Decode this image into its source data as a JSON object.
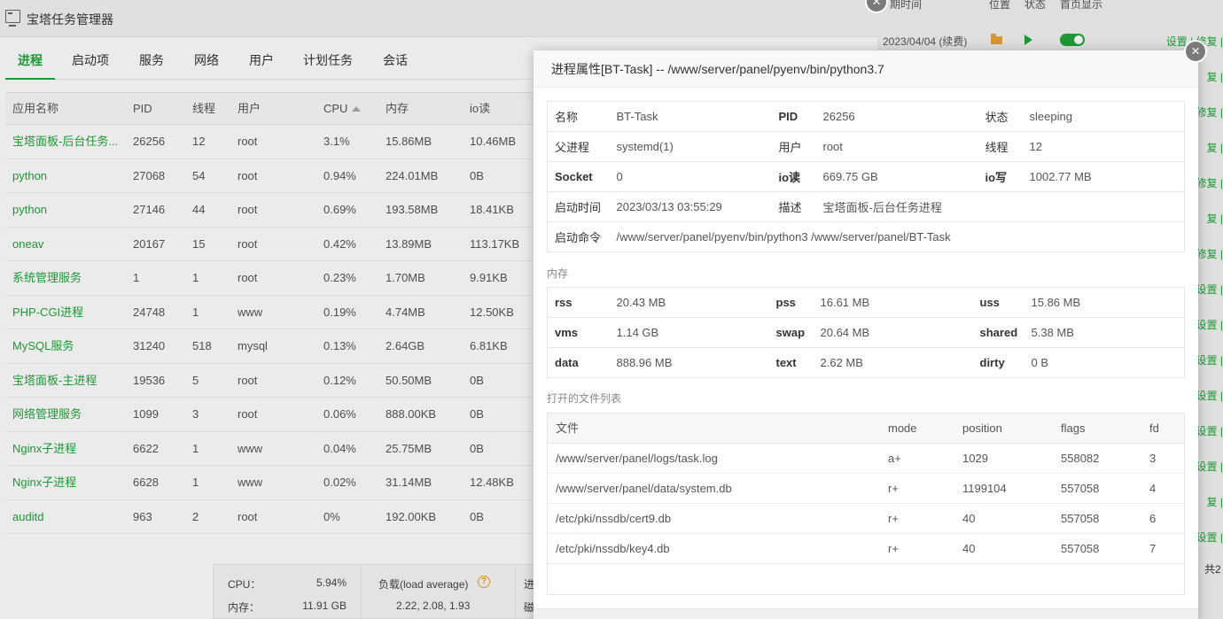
{
  "app": {
    "title": "宝塔任务管理器"
  },
  "tabs": [
    "进程",
    "启动项",
    "服务",
    "网络",
    "用户",
    "计划任务",
    "会话"
  ],
  "process_table": {
    "columns": [
      "应用名称",
      "PID",
      "线程",
      "用户",
      "CPU",
      "内存",
      "io读"
    ],
    "rows": [
      [
        "宝塔面板-后台任务...",
        "26256",
        "12",
        "root",
        "3.1%",
        "15.86MB",
        "10.46MB"
      ],
      [
        "python",
        "27068",
        "54",
        "root",
        "0.94%",
        "224.01MB",
        "0B"
      ],
      [
        "python",
        "27146",
        "44",
        "root",
        "0.69%",
        "193.58MB",
        "18.41KB"
      ],
      [
        "oneav",
        "20167",
        "15",
        "root",
        "0.42%",
        "13.89MB",
        "113.17KB"
      ],
      [
        "系统管理服务",
        "1",
        "1",
        "root",
        "0.23%",
        "1.70MB",
        "9.91KB"
      ],
      [
        "PHP-CGI进程",
        "24748",
        "1",
        "www",
        "0.19%",
        "4.74MB",
        "12.50KB"
      ],
      [
        "MySQL服务",
        "31240",
        "518",
        "mysql",
        "0.13%",
        "2.64GB",
        "6.81KB"
      ],
      [
        "宝塔面板-主进程",
        "19536",
        "5",
        "root",
        "0.12%",
        "50.50MB",
        "0B"
      ],
      [
        "网络管理服务",
        "1099",
        "3",
        "root",
        "0.06%",
        "888.00KB",
        "0B"
      ],
      [
        "Nginx子进程",
        "6622",
        "1",
        "www",
        "0.04%",
        "25.75MB",
        "0B"
      ],
      [
        "Nginx子进程",
        "6628",
        "1",
        "www",
        "0.02%",
        "31.14MB",
        "12.48KB"
      ],
      [
        "auditd",
        "963",
        "2",
        "root",
        "0%",
        "192.00KB",
        "0B"
      ]
    ]
  },
  "footer_stats": {
    "cpu_label": "CPU：",
    "cpu_value": "5.94%",
    "mem_label": "内存：",
    "mem_value": "11.91 GB",
    "load_label": "负载(load average)",
    "load_value": "2.22, 2.08, 1.93",
    "proc_label": "进",
    "disk_label": "磁"
  },
  "right_panel": {
    "head_time": "期时间",
    "head_pos": "位置",
    "head_status": "状态",
    "head_home": "首页显示",
    "row_date": "2023/04/04 (续费)",
    "links": [
      "设置 | 修复 |",
      "复 |",
      "修复 |",
      "复 |",
      "修复 |",
      "复 |",
      "修复 |",
      "设置 |",
      "设置 |",
      "设置 |",
      "设置 |",
      "设置 |",
      "设置 |",
      "复 |",
      "设置 |"
    ],
    "total_prefix": "共2"
  },
  "modal": {
    "title": "进程属性[BT-Task] -- /www/server/panel/pyenv/bin/python3.7",
    "close_glyph": "×",
    "basic": {
      "name_label": "名称",
      "name_value": "BT-Task",
      "pid_label": "PID",
      "pid_value": "26256",
      "status_label": "状态",
      "status_value": "sleeping",
      "parent_label": "父进程",
      "parent_value": "systemd(1)",
      "user_label": "用户",
      "user_value": "root",
      "threads_label": "线程",
      "threads_value": "12",
      "socket_label": "Socket",
      "socket_value": "0",
      "ioread_label": "io读",
      "ioread_value": "669.75 GB",
      "iowrite_label": "io写",
      "iowrite_value": "1002.77 MB",
      "start_label": "启动时间",
      "start_value": "2023/03/13 03:55:29",
      "desc_label": "描述",
      "desc_value": "宝塔面板-后台任务进程",
      "cmd_label": "启动命令",
      "cmd_value": "/www/server/panel/pyenv/bin/python3 /www/server/panel/BT-Task"
    },
    "memory_title": "内存",
    "memory": {
      "rss": "20.43 MB",
      "pss": "16.61 MB",
      "uss": "15.86 MB",
      "vms": "1.14 GB",
      "swap": "20.64 MB",
      "shared": "5.38 MB",
      "data": "888.96 MB",
      "text": "2.62 MB",
      "dirty": "0 B"
    },
    "memory_labels": {
      "rss": "rss",
      "pss": "pss",
      "uss": "uss",
      "vms": "vms",
      "swap": "swap",
      "shared": "shared",
      "data": "data",
      "text": "text",
      "dirty": "dirty"
    },
    "files_title": "打开的文件列表",
    "files_columns": [
      "文件",
      "mode",
      "position",
      "flags",
      "fd"
    ],
    "files": [
      [
        "/www/server/panel/logs/task.log",
        "a+",
        "1029",
        "558082",
        "3"
      ],
      [
        "/www/server/panel/data/system.db",
        "r+",
        "1199104",
        "557058",
        "4"
      ],
      [
        "/etc/pki/nssdb/cert9.db",
        "r+",
        "40",
        "557058",
        "6"
      ],
      [
        "/etc/pki/nssdb/key4.db",
        "r+",
        "40",
        "557058",
        "7"
      ]
    ]
  }
}
